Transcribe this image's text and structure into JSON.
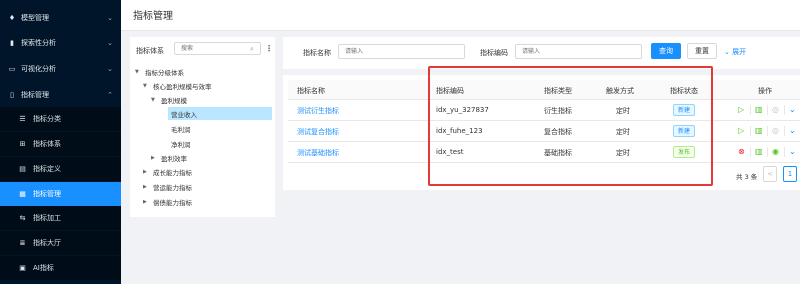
{
  "sidebar": {
    "items": [
      {
        "label": "模型管理",
        "icon": "location-pin-icon",
        "arrow": "⌄"
      },
      {
        "label": "探索性分析",
        "icon": "bar-chart-icon",
        "arrow": "⌄"
      },
      {
        "label": "可视化分析",
        "icon": "monitor-icon",
        "arrow": "⌄"
      },
      {
        "label": "指标管理",
        "icon": "document-icon",
        "arrow": "⌃"
      }
    ],
    "subitems": [
      {
        "label": "指标分类",
        "icon": "list-icon"
      },
      {
        "label": "指标体系",
        "icon": "hierarchy-icon"
      },
      {
        "label": "指标定义",
        "icon": "doc-edit-icon"
      },
      {
        "label": "指标管理",
        "icon": "grid-icon",
        "active": true
      },
      {
        "label": "指标加工",
        "icon": "swap-icon"
      },
      {
        "label": "指标大厅",
        "icon": "menu-lines-icon"
      },
      {
        "label": "AI指标",
        "icon": "chat-icon"
      }
    ]
  },
  "header": {
    "title": "指标管理"
  },
  "tree": {
    "label": "指标体系",
    "search_placeholder": "搜索",
    "nodes": [
      {
        "label": "指标分级体系",
        "caret": "▼"
      },
      {
        "label": "核心盈利规模与效率",
        "caret": "▼"
      },
      {
        "label": "盈利规模",
        "caret": "▼"
      },
      {
        "label": "营业收入",
        "caret": "",
        "selected": true
      },
      {
        "label": "毛利润",
        "caret": ""
      },
      {
        "label": "净利润",
        "caret": ""
      },
      {
        "label": "盈利效率",
        "caret": "▶"
      },
      {
        "label": "成长能力指标",
        "caret": "▶"
      },
      {
        "label": "营运能力指标",
        "caret": "▶"
      },
      {
        "label": "偿债能力指标",
        "caret": "▶"
      }
    ]
  },
  "search": {
    "name_label": "指标名称",
    "name_placeholder": "请输入",
    "code_label": "指标编码",
    "code_placeholder": "请输入",
    "query_label": "查询",
    "reset_label": "重置",
    "expand_label": "展开",
    "expand_icon": "⌄"
  },
  "table": {
    "headers": [
      "指标名称",
      "指标编码",
      "指标类型",
      "触发方式",
      "指标状态",
      "操作"
    ],
    "rows": [
      {
        "name": "测试衍生指标",
        "code": "idx_yu_327837",
        "type": "衍生指标",
        "trigger": "定时",
        "status": "新建",
        "status_kind": "new"
      },
      {
        "name": "测试复合指标",
        "code": "idx_fuhe_123",
        "type": "复合指标",
        "trigger": "定时",
        "status": "新建",
        "status_kind": "new"
      },
      {
        "name": "测试基础指标",
        "code": "idx_test",
        "type": "基础指标",
        "trigger": "定时",
        "status": "发布",
        "status_kind": "pub"
      }
    ],
    "total": "共 3 条",
    "page": "1",
    "prev": "<"
  },
  "colors": {
    "accent": "#1890ff",
    "sidebar_bg": "#001529",
    "highlight": "#e53935"
  }
}
